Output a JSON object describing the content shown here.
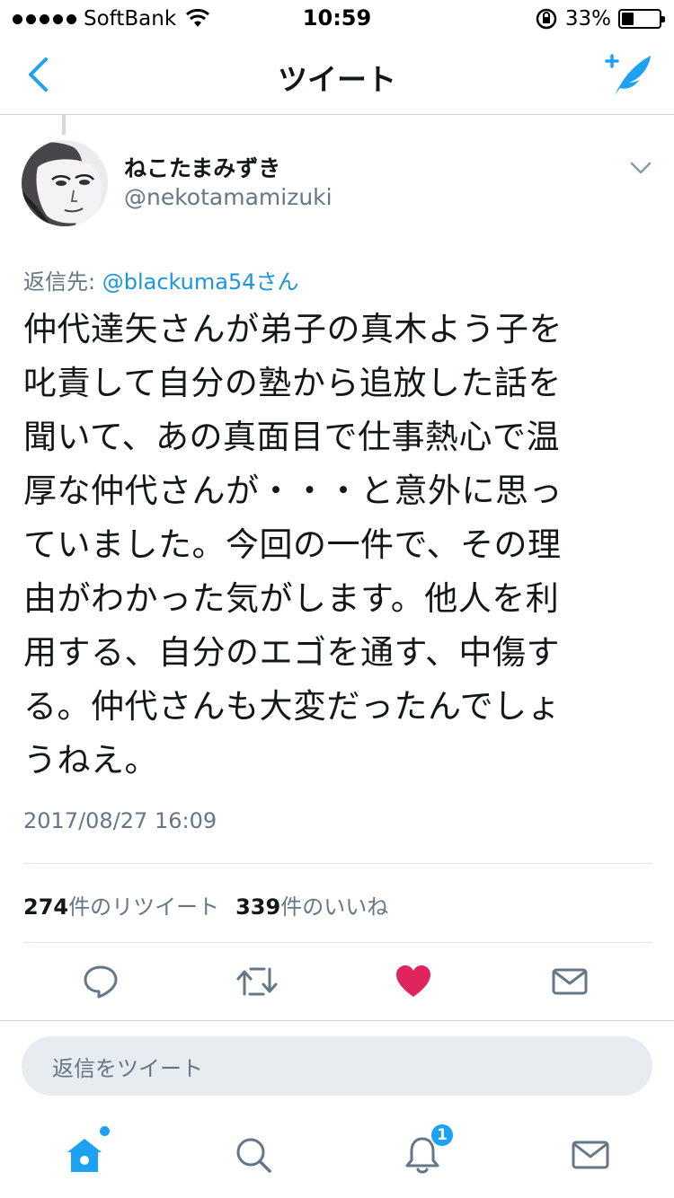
{
  "status_bar": {
    "carrier": "SoftBank",
    "time": "10:59",
    "battery_percent": "33%",
    "battery_level": 0.33
  },
  "nav": {
    "title": "ツイート",
    "back_icon": "chevron-left-icon",
    "compose_icon": "compose-tweet-icon"
  },
  "tweet": {
    "author_name": "ねこたまみずき",
    "author_handle": "@nekotamamizuki",
    "reply_label": "返信先: ",
    "reply_target": "@blackuma54さん",
    "text_lines": [
      "仲代達矢さんが弟子の真木よう子を",
      "叱責して自分の塾から追放した話を",
      "聞いて、あの真面目で仕事熱心で温",
      "厚な仲代さんが・・・と意外に思っ",
      "ていました。今回の一件で、その理",
      "由がわかった気がします。他人を利",
      "用する、自分のエゴを通す、中傷す",
      "る。仲代さんも大変だったんでしょ",
      "うねえ。"
    ],
    "timestamp": "2017/08/27 16:09",
    "retweet_count": "274",
    "retweet_label": "件のリツイート",
    "like_count": "339",
    "like_label": "件のいいね"
  },
  "actions": {
    "reply_icon": "reply-icon",
    "retweet_icon": "retweet-icon",
    "like_icon": "heart-icon",
    "like_color": "#e0245e",
    "message_icon": "mail-icon"
  },
  "reply_box": {
    "placeholder": "返信をツイート"
  },
  "tab_bar": {
    "accent": "#1da1f2",
    "items": [
      {
        "name": "home",
        "icon": "home-icon",
        "active": true
      },
      {
        "name": "search",
        "icon": "search-icon",
        "active": false
      },
      {
        "name": "notifications",
        "icon": "bell-icon",
        "badge": "1",
        "active": false
      },
      {
        "name": "messages",
        "icon": "mail-icon",
        "active": false
      }
    ]
  }
}
